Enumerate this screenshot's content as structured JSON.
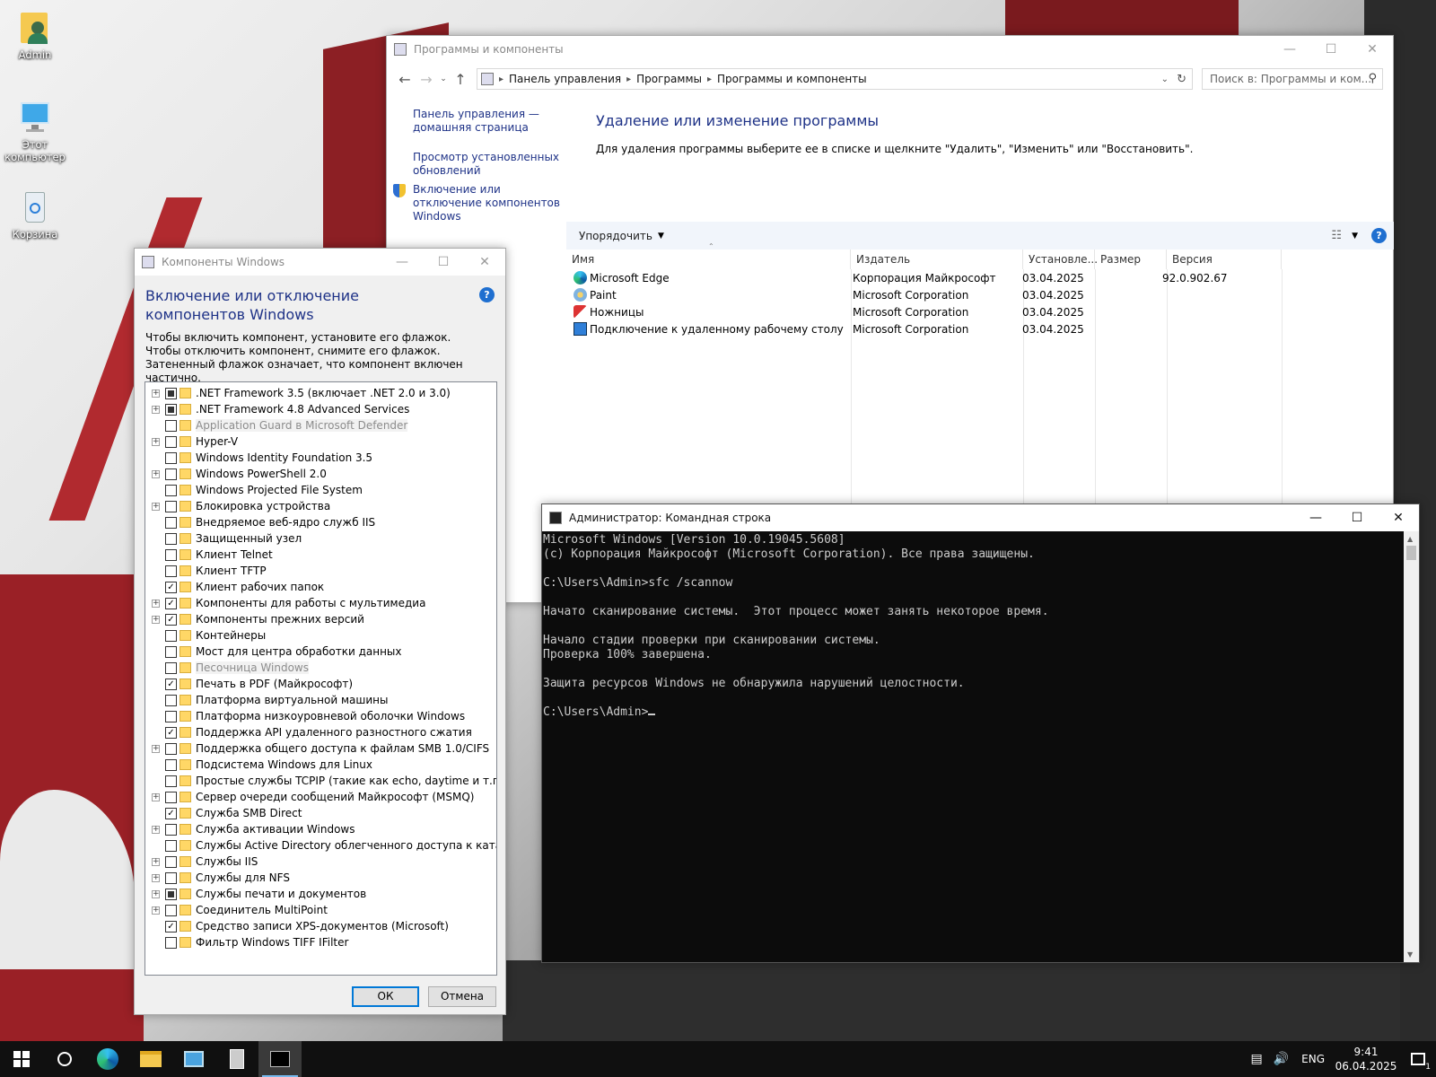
{
  "desktop": {
    "icons": [
      {
        "label": "Admin"
      },
      {
        "label": "Этот компьютер"
      },
      {
        "label": "Корзина"
      }
    ]
  },
  "programs_window": {
    "title": "Программы и компоненты",
    "breadcrumb": [
      "Панель управления",
      "Программы",
      "Программы и компоненты"
    ],
    "search_placeholder": "Поиск в: Программы и ком...",
    "left_links": [
      "Панель управления — домашняя страница",
      "Просмотр установленных обновлений",
      "Включение или отключение компонентов Windows"
    ],
    "heading": "Удаление или изменение программы",
    "description": "Для удаления программы выберите ее в списке и щелкните \"Удалить\", \"Изменить\" или \"Восстановить\".",
    "organize_label": "Упорядочить",
    "columns": [
      "Имя",
      "Издатель",
      "Установле...",
      "Размер",
      "Версия"
    ],
    "programs": [
      {
        "name": "Microsoft Edge",
        "publisher": "Корпорация Майкрософт",
        "installed": "03.04.2025",
        "size": "",
        "version": "92.0.902.67",
        "icon": "edge-icon"
      },
      {
        "name": "Paint",
        "publisher": "Microsoft Corporation",
        "installed": "03.04.2025",
        "size": "",
        "version": "",
        "icon": "paint-icon"
      },
      {
        "name": "Ножницы",
        "publisher": "Microsoft Corporation",
        "installed": "03.04.2025",
        "size": "",
        "version": "",
        "icon": "snipping-icon"
      },
      {
        "name": "Подключение к удаленному рабочему столу",
        "publisher": "Microsoft Corporation",
        "installed": "03.04.2025",
        "size": "",
        "version": "",
        "icon": "rdp-icon"
      }
    ]
  },
  "components_window": {
    "title": "Компоненты Windows",
    "heading": "Включение или отключение компонентов Windows",
    "description": "Чтобы включить компонент, установите его флажок. Чтобы отключить компонент, снимите его флажок. Затененный флажок означает, что компонент включен частично.",
    "features": [
      {
        "label": ".NET Framework 3.5 (включает .NET 2.0 и 3.0)",
        "expandable": true,
        "state": "partial",
        "disabled": false
      },
      {
        "label": ".NET Framework 4.8 Advanced Services",
        "expandable": true,
        "state": "partial",
        "disabled": false
      },
      {
        "label": "Application Guard в Microsoft Defender",
        "expandable": false,
        "state": "unchecked",
        "disabled": true
      },
      {
        "label": "Hyper-V",
        "expandable": true,
        "state": "unchecked",
        "disabled": false
      },
      {
        "label": "Windows Identity Foundation 3.5",
        "expandable": false,
        "state": "unchecked",
        "disabled": false
      },
      {
        "label": "Windows PowerShell 2.0",
        "expandable": true,
        "state": "unchecked",
        "disabled": false
      },
      {
        "label": "Windows Projected File System",
        "expandable": false,
        "state": "unchecked",
        "disabled": false
      },
      {
        "label": "Блокировка устройства",
        "expandable": true,
        "state": "unchecked",
        "disabled": false
      },
      {
        "label": "Внедряемое веб-ядро служб IIS",
        "expandable": false,
        "state": "unchecked",
        "disabled": false
      },
      {
        "label": "Защищенный узел",
        "expandable": false,
        "state": "unchecked",
        "disabled": false
      },
      {
        "label": "Клиент Telnet",
        "expandable": false,
        "state": "unchecked",
        "disabled": false
      },
      {
        "label": "Клиент TFTP",
        "expandable": false,
        "state": "unchecked",
        "disabled": false
      },
      {
        "label": "Клиент рабочих папок",
        "expandable": false,
        "state": "checked",
        "disabled": false
      },
      {
        "label": "Компоненты для работы с мультимедиа",
        "expandable": true,
        "state": "checked",
        "disabled": false
      },
      {
        "label": "Компоненты прежних версий",
        "expandable": true,
        "state": "checked",
        "disabled": false
      },
      {
        "label": "Контейнеры",
        "expandable": false,
        "state": "unchecked",
        "disabled": false
      },
      {
        "label": "Мост для центра обработки данных",
        "expandable": false,
        "state": "unchecked",
        "disabled": false
      },
      {
        "label": "Песочница Windows",
        "expandable": false,
        "state": "unchecked",
        "disabled": true
      },
      {
        "label": "Печать в PDF (Майкрософт)",
        "expandable": false,
        "state": "checked",
        "disabled": false
      },
      {
        "label": "Платформа виртуальной машины",
        "expandable": false,
        "state": "unchecked",
        "disabled": false
      },
      {
        "label": "Платформа низкоуровневой оболочки Windows",
        "expandable": false,
        "state": "unchecked",
        "disabled": false
      },
      {
        "label": "Поддержка API удаленного разностного сжатия",
        "expandable": false,
        "state": "checked",
        "disabled": false
      },
      {
        "label": "Поддержка общего доступа к файлам SMB 1.0/CIFS",
        "expandable": true,
        "state": "unchecked",
        "disabled": false
      },
      {
        "label": "Подсистема Windows для Linux",
        "expandable": false,
        "state": "unchecked",
        "disabled": false
      },
      {
        "label": "Простые службы TCPIP (такие как echo, daytime и т.п.)",
        "expandable": false,
        "state": "unchecked",
        "disabled": false
      },
      {
        "label": "Сервер очереди сообщений Майкрософт (MSMQ)",
        "expandable": true,
        "state": "unchecked",
        "disabled": false
      },
      {
        "label": "Служба SMB Direct",
        "expandable": false,
        "state": "checked",
        "disabled": false
      },
      {
        "label": "Служба активации Windows",
        "expandable": true,
        "state": "unchecked",
        "disabled": false
      },
      {
        "label": "Службы Active Directory облегченного доступа к каталогам",
        "expandable": false,
        "state": "unchecked",
        "disabled": false
      },
      {
        "label": "Службы IIS",
        "expandable": true,
        "state": "unchecked",
        "disabled": false
      },
      {
        "label": "Службы для NFS",
        "expandable": true,
        "state": "unchecked",
        "disabled": false
      },
      {
        "label": "Службы печати и документов",
        "expandable": true,
        "state": "partial",
        "disabled": false
      },
      {
        "label": "Соединитель MultiPoint",
        "expandable": true,
        "state": "unchecked",
        "disabled": false
      },
      {
        "label": "Средство записи XPS-документов (Microsoft)",
        "expandable": false,
        "state": "checked",
        "disabled": false
      },
      {
        "label": "Фильтр Windows TIFF IFilter",
        "expandable": false,
        "state": "unchecked",
        "disabled": false
      }
    ],
    "ok_label": "ОК",
    "cancel_label": "Отмена"
  },
  "cmd_window": {
    "title": "Администратор: Командная строка",
    "lines": [
      "Microsoft Windows [Version 10.0.19045.5608]",
      "(c) Корпорация Майкрософт (Microsoft Corporation). Все права защищены.",
      "",
      "C:\\Users\\Admin>sfc /scannow",
      "",
      "Начато сканирование системы.  Этот процесс может занять некоторое время.",
      "",
      "Начало стадии проверки при сканировании системы.",
      "Проверка 100% завершена.",
      "",
      "Защита ресурсов Windows не обнаружила нарушений целостности.",
      "",
      "C:\\Users\\Admin>"
    ]
  },
  "taskbar": {
    "language": "ENG",
    "time": "9:41",
    "date": "06.04.2025",
    "notification_count": "1"
  }
}
